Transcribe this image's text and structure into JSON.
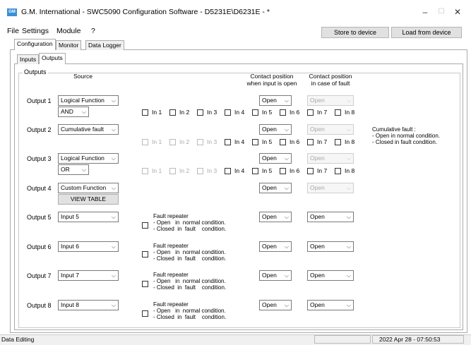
{
  "window": {
    "icon_text": "GM",
    "title": "G.M. International - SWC5090 Configuration Software - D5231E\\D6231E - *",
    "min": "–",
    "max": "☐",
    "close": "✕"
  },
  "menu": [
    "File",
    "Settings",
    "Module",
    "?"
  ],
  "toolbar": {
    "store": "Store to device",
    "load": "Load from device"
  },
  "tabs_top": [
    "Configuration",
    "Monitor",
    "Data Logger"
  ],
  "tabs_sub": [
    "Inputs",
    "Outputs"
  ],
  "group_label": "Outputs",
  "headers": {
    "source": "Source",
    "contact_open_1": "Contact position",
    "contact_open_2": "when input is open",
    "contact_fault_1": "Contact position",
    "contact_fault_2": "in case of fault"
  },
  "inputs_labels": [
    "In 1",
    "In 2",
    "In 3",
    "In 4",
    "In 5",
    "In 6",
    "In 7",
    "In 8"
  ],
  "outputs": [
    {
      "label": "Output 1",
      "source": "Logical Function",
      "sub": "AND",
      "open": "Open",
      "fault": "Open"
    },
    {
      "label": "Output 2",
      "source": "Cumulative fault",
      "open": "Open",
      "fault": "Open"
    },
    {
      "label": "Output 3",
      "source": "Logical Function",
      "sub": "OR",
      "open": "Open",
      "fault": "Open"
    },
    {
      "label": "Output 4",
      "source": "Custom Function",
      "button": "VIEW TABLE",
      "open": "Open",
      "fault": "Open"
    },
    {
      "label": "Output 5",
      "source": "Input 5",
      "open": "Open",
      "fault": "Open"
    },
    {
      "label": "Output 6",
      "source": "Input 6",
      "open": "Open",
      "fault": "Open"
    },
    {
      "label": "Output 7",
      "source": "Input 7",
      "open": "Open",
      "fault": "Open"
    },
    {
      "label": "Output 8",
      "source": "Input 8",
      "open": "Open",
      "fault": "Open"
    }
  ],
  "fault_repeater": {
    "title": "Fault repeater",
    "line1": "- Open   in  normal condition.",
    "line2": "- Closed  in  fault    condition."
  },
  "cumulative_note": {
    "title": "Cumulative fault :",
    "line1": "- Open in normal condition.",
    "line2": "- Closed in fault condition."
  },
  "status": {
    "left": "Data Editing",
    "right": "2022 Apr 28 - 07:50:53"
  }
}
